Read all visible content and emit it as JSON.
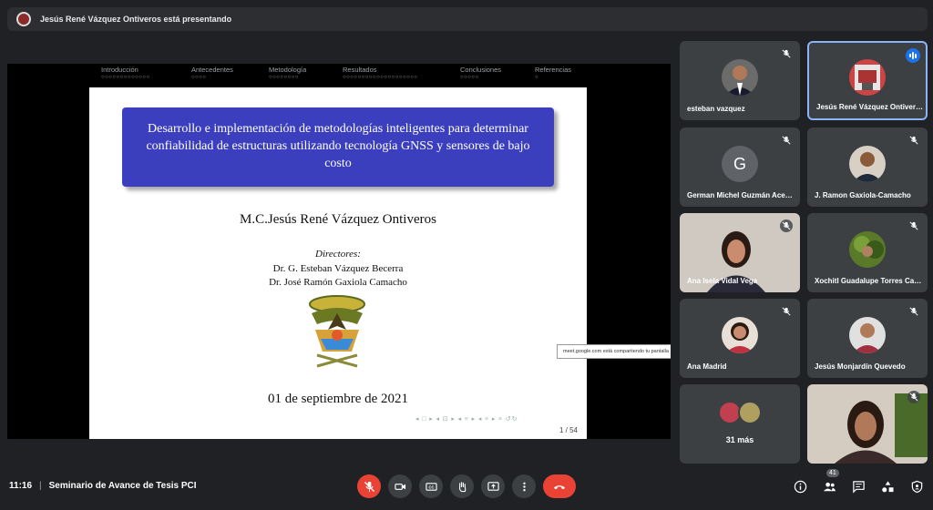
{
  "presenting_bar": {
    "text": "Jesús René Vázquez Ontiveros está presentando"
  },
  "slide_nav": [
    {
      "label": "Introducción",
      "dots": "○○○○○○○○○○○○○"
    },
    {
      "label": "Antecedentes",
      "dots": "○○○○"
    },
    {
      "label": "Metodología",
      "dots": "○○○○○○○○"
    },
    {
      "label": "Resultados",
      "dots": "○○○○○○○○○○○○○○○○○○○○"
    },
    {
      "label": "Conclusiones",
      "dots": "○○○○○"
    },
    {
      "label": "Referencias",
      "dots": "○"
    }
  ],
  "slide": {
    "title": "Desarrollo e implementación de metodologías inteligentes para determinar confiabilidad de estructuras utilizando tecnología GNSS y sensores de bajo costo",
    "author": "M.C.Jesús René Vázquez Ontiveros",
    "directors_label": "Directores:",
    "director1": "Dr. G. Esteban Vázquez Becerra",
    "director2": "Dr. José Ramón Gaxiola Camacho",
    "date": "01 de septiembre de 2021",
    "nav_symbols": "◂ □ ▸ ◂ ⊡ ▸ ◂ ≡ ▸ ◂ ≡ ▸  ≡  ↺↻",
    "page": "1 / 54"
  },
  "tooltip": "meet.google.com está compartiendo tu pantalla",
  "participants": [
    {
      "name": "esteban vazquez"
    },
    {
      "name": "Jesús René Vázquez Ontiveros"
    },
    {
      "name": "German Michel Guzmán Acevedo",
      "initial": "G"
    },
    {
      "name": "J. Ramon Gaxiola-Camacho"
    },
    {
      "name": "Ana Isela Vidal Vega"
    },
    {
      "name": "Xochitl Guadalupe Torres Carrillo"
    },
    {
      "name": "Ana Madrid"
    },
    {
      "name": "Jesús Monjardín Quevedo"
    },
    {
      "name": "31 más"
    },
    {
      "name": ""
    }
  ],
  "bottom": {
    "time": "11:16",
    "meeting": "Seminario de Avance de Tesis PCI",
    "participant_count": "41"
  },
  "colors": {
    "accent": "#8ab4f8",
    "danger": "#ea4335",
    "slide_title_bg": "#3b3fbd",
    "tile_bg": "#3c4043"
  }
}
